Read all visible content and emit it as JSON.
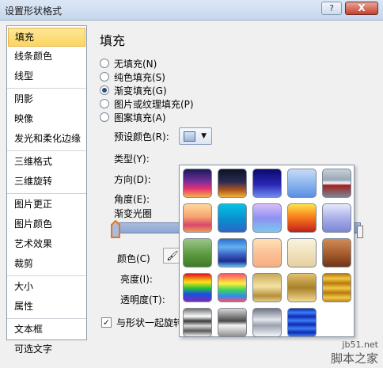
{
  "window": {
    "title": "设置形状格式",
    "help_label": "?",
    "close_label": "X"
  },
  "sidebar": {
    "items": [
      {
        "label": "填充"
      },
      {
        "label": "线条颜色"
      },
      {
        "label": "线型"
      },
      {
        "label": "阴影"
      },
      {
        "label": "映像"
      },
      {
        "label": "发光和柔化边缘"
      },
      {
        "label": "三维格式"
      },
      {
        "label": "三维旋转"
      },
      {
        "label": "图片更正"
      },
      {
        "label": "图片颜色"
      },
      {
        "label": "艺术效果"
      },
      {
        "label": "裁剪"
      },
      {
        "label": "大小"
      },
      {
        "label": "属性"
      },
      {
        "label": "文本框"
      },
      {
        "label": "可选文字"
      }
    ]
  },
  "fill": {
    "heading": "填充",
    "options": [
      {
        "label": "无填充(N)"
      },
      {
        "label": "纯色填充(S)"
      },
      {
        "label": "渐变填充(G)"
      },
      {
        "label": "图片或纹理填充(P)"
      },
      {
        "label": "图案填充(A)"
      }
    ],
    "preset_label": "预设颜色(R):",
    "type_label": "类型(Y):",
    "direction_label": "方向(D):",
    "angle_label": "角度(E):",
    "gradient_stops_label": "渐变光圈",
    "color_label": "颜色(C)",
    "brightness_label": "亮度(I):",
    "transparency_label": "透明度(T):",
    "rotate_with_shape_label": "与形状一起旋转(W)",
    "rotate_checked": "✓"
  },
  "preset_popup": {
    "rows": 5,
    "cols": 5,
    "swatch_count": 24
  },
  "icons": {
    "dropdown": "▼",
    "paint": "🖌"
  },
  "watermark": {
    "url": "jb51.net",
    "site": "脚本之家"
  }
}
